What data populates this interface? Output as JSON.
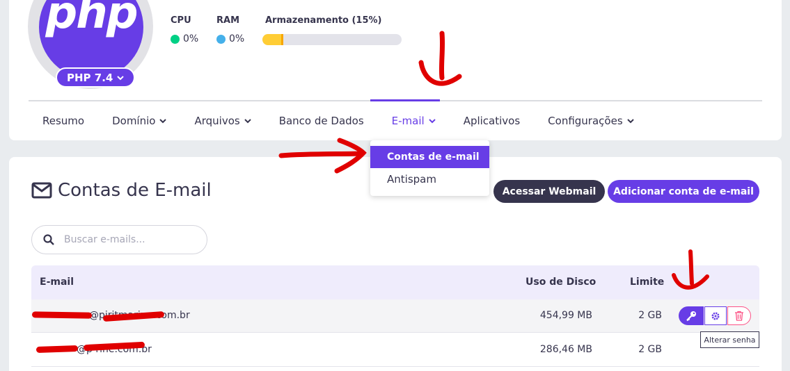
{
  "php": {
    "logo_text": "php",
    "version_label": "PHP 7.4"
  },
  "metrics": {
    "cpu": {
      "label": "CPU",
      "value": "0%",
      "color": "#00d085"
    },
    "ram": {
      "label": "RAM",
      "value": "0%",
      "color": "#45b0ea"
    },
    "storage": {
      "label": "Armazenamento (15%)",
      "percent": 15,
      "color": "#ffcd35"
    }
  },
  "nav": {
    "items": [
      {
        "label": "Resumo",
        "dropdown": false
      },
      {
        "label": "Domínio",
        "dropdown": true
      },
      {
        "label": "Arquivos",
        "dropdown": true
      },
      {
        "label": "Banco de Dados",
        "dropdown": false
      },
      {
        "label": "E-mail",
        "dropdown": true,
        "active": true
      },
      {
        "label": "Aplicativos",
        "dropdown": false
      },
      {
        "label": "Configurações",
        "dropdown": true
      }
    ]
  },
  "email_dropdown": {
    "items": [
      "Contas de e-mail",
      "Antispam"
    ]
  },
  "page": {
    "title": "Contas de E-mail",
    "webmail_button": "Acessar Webmail",
    "add_button": "Adicionar conta de e-mail",
    "search_placeholder": "Buscar e-mails..."
  },
  "table": {
    "headers": {
      "email": "E-mail",
      "disk": "Uso de Disco",
      "limit": "Limite"
    },
    "rows": [
      {
        "email_visible": "@piritmarine.com.br",
        "disk": "454,99 MB",
        "limit": "2 GB"
      },
      {
        "email_visible": "@p         rine.com.br",
        "disk": "286,46 MB",
        "limit": "2 GB"
      }
    ]
  },
  "tooltip": "Alterar senha",
  "colors": {
    "primary": "#673de6",
    "dark": "#36344d",
    "danger": "#fc5185",
    "annotation": "#e00000"
  }
}
